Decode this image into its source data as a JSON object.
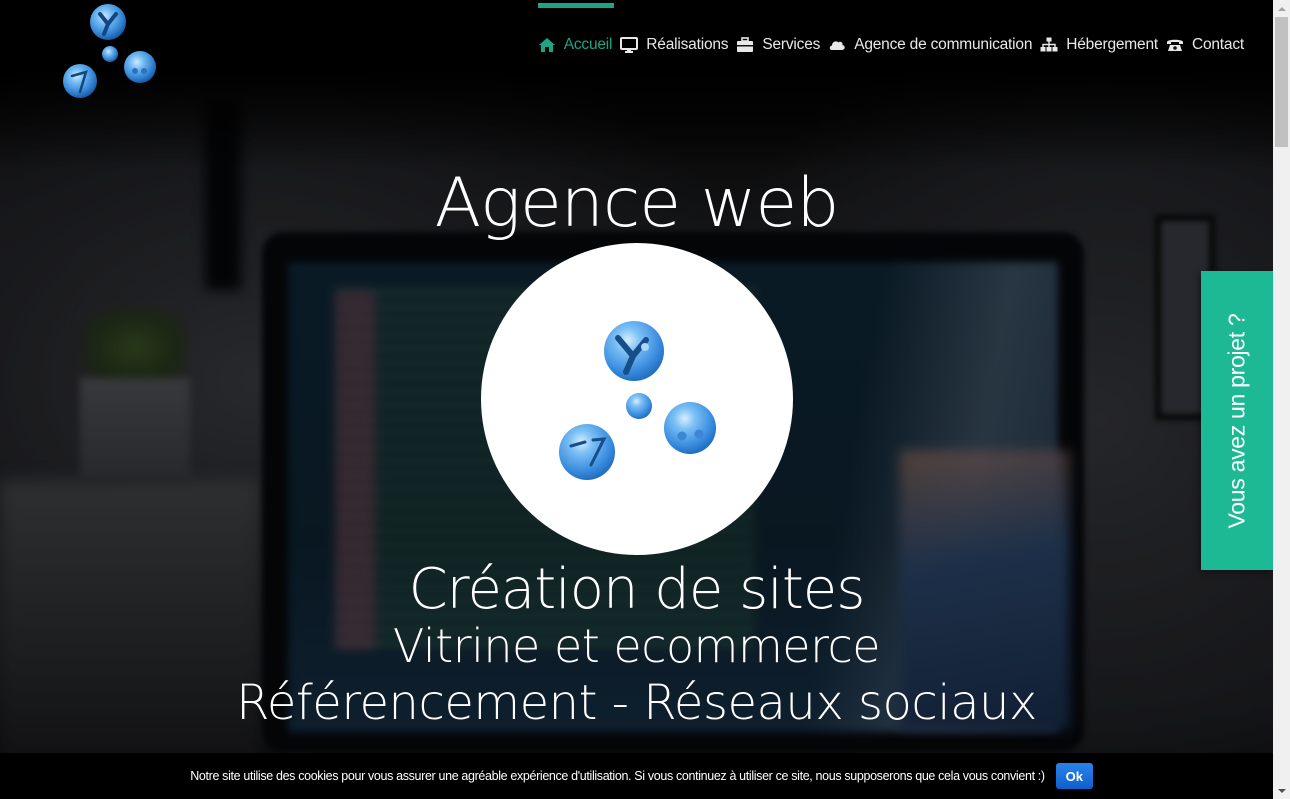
{
  "header": {
    "logo_alt": "Agence web logo (blue spheres)",
    "nav": [
      {
        "label": "Accueil",
        "icon": "home-icon",
        "active": true
      },
      {
        "label": "Réalisations",
        "icon": "desktop-icon",
        "active": false
      },
      {
        "label": "Services",
        "icon": "briefcase-icon",
        "active": false
      },
      {
        "label": "Agence de communication",
        "icon": "cloud-icon",
        "active": false
      },
      {
        "label": "Hébergement",
        "icon": "sitemap-icon",
        "active": false
      },
      {
        "label": "Contact",
        "icon": "phone-icon",
        "active": false
      }
    ]
  },
  "hero": {
    "title": "Agence web",
    "line1": "Création de sites",
    "line2": "Vitrine et ecommerce",
    "line3": "Référencement - Réseaux sociaux"
  },
  "side_tab": {
    "label": "Vous avez un projet ?"
  },
  "cookie_bar": {
    "message": "Notre site utilise des cookies pour vous assurer une agréable expérience d'utilisation. Si vous continuez à utiliser ce site, nous supposerons que cela vous convient :)",
    "ok_label": "Ok"
  },
  "colors": {
    "accent": "#1fa385",
    "side_tab": "#1db995",
    "ok_button": "#1a6fdc",
    "nav_text": "#e8e8e8"
  }
}
